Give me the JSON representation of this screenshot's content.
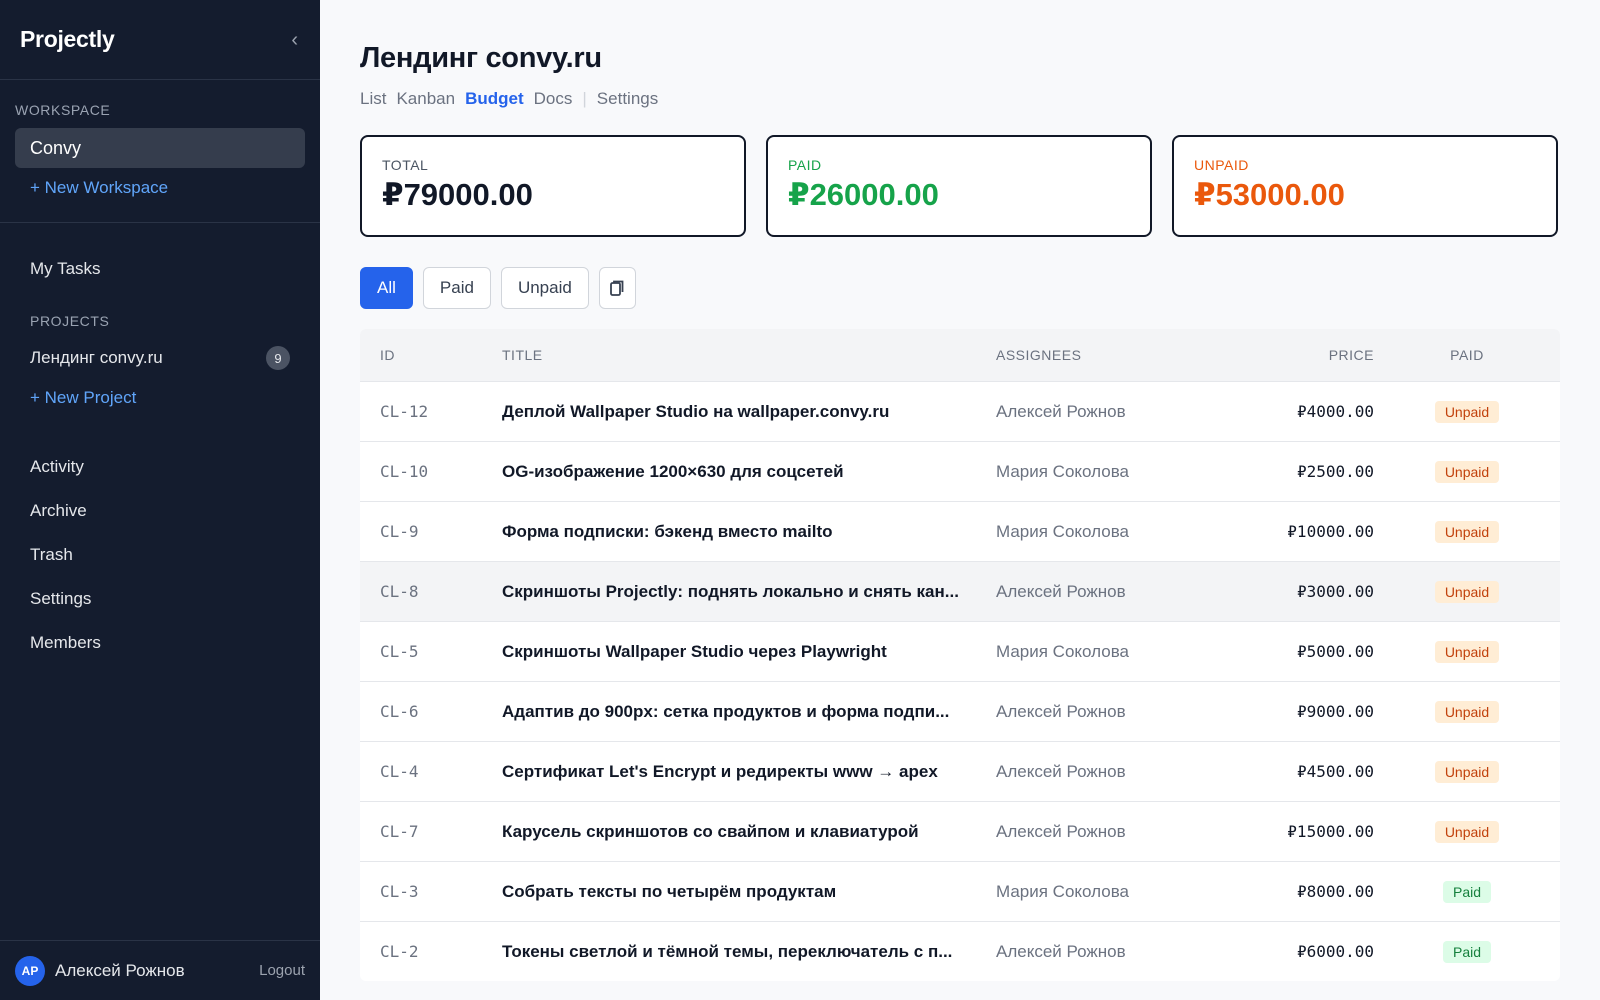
{
  "app": {
    "brand": "Projectly",
    "collapse_glyph": "‹"
  },
  "sidebar": {
    "workspace_label": "WORKSPACE",
    "workspace": "Convy",
    "new_workspace": "+ New Workspace",
    "my_tasks": "My Tasks",
    "projects_label": "PROJECTS",
    "project": {
      "name": "Лендинг convy.ru",
      "count": "9"
    },
    "new_project": "+ New Project",
    "nav": [
      "Activity",
      "Archive",
      "Trash",
      "Settings",
      "Members"
    ],
    "user": {
      "initials": "АР",
      "name": "Алексей Рожнов",
      "logout": "Logout"
    }
  },
  "page": {
    "title": "Лендинг convy.ru",
    "tabs": [
      "List",
      "Kanban",
      "Budget",
      "Docs"
    ],
    "active_tab": "Budget",
    "tab_separator": "|",
    "settings_tab": "Settings"
  },
  "summary": {
    "total": {
      "label": "TOTAL",
      "value": "₽79000.00"
    },
    "paid": {
      "label": "PAID",
      "value": "₽26000.00"
    },
    "unpaid": {
      "label": "UNPAID",
      "value": "₽53000.00"
    }
  },
  "filters": {
    "all": "All",
    "paid": "Paid",
    "unpaid": "Unpaid",
    "icon": "clipboard-icon"
  },
  "table": {
    "headers": {
      "id": "ID",
      "title": "TITLE",
      "assignees": "ASSIGNEES",
      "price": "PRICE",
      "paid": "PAID"
    },
    "rows": [
      {
        "id": "CL-12",
        "title": "Деплой Wallpaper Studio на wallpaper.convy.ru",
        "assignee": "Алексей Рожнов",
        "price": "₽4000.00",
        "status": "Unpaid"
      },
      {
        "id": "CL-10",
        "title": "OG-изображение 1200×630 для соцсетей",
        "assignee": "Мария Соколова",
        "price": "₽2500.00",
        "status": "Unpaid"
      },
      {
        "id": "CL-9",
        "title": "Форма подписки: бэкенд вместо mailto",
        "assignee": "Мария Соколова",
        "price": "₽10000.00",
        "status": "Unpaid"
      },
      {
        "id": "CL-8",
        "title": "Скриншоты Projectly: поднять локально и снять кан...",
        "assignee": "Алексей Рожнов",
        "price": "₽3000.00",
        "status": "Unpaid"
      },
      {
        "id": "CL-5",
        "title": "Скриншоты Wallpaper Studio через Playwright",
        "assignee": "Мария Соколова",
        "price": "₽5000.00",
        "status": "Unpaid"
      },
      {
        "id": "CL-6",
        "title": "Адаптив до 900px: сетка продуктов и форма подпи...",
        "assignee": "Алексей Рожнов",
        "price": "₽9000.00",
        "status": "Unpaid"
      },
      {
        "id": "CL-4",
        "title": "Сертификат Let's Encrypt и редиректы www → apex",
        "assignee": "Алексей Рожнов",
        "price": "₽4500.00",
        "status": "Unpaid"
      },
      {
        "id": "CL-7",
        "title": "Карусель скриншотов со свайпом и клавиатурой",
        "assignee": "Алексей Рожнов",
        "price": "₽15000.00",
        "status": "Unpaid"
      },
      {
        "id": "CL-3",
        "title": "Собрать тексты по четырём продуктам",
        "assignee": "Мария Соколова",
        "price": "₽8000.00",
        "status": "Paid"
      },
      {
        "id": "CL-2",
        "title": "Токены светлой и тёмной темы, переключатель с п...",
        "assignee": "Алексей Рожнов",
        "price": "₽6000.00",
        "status": "Paid"
      }
    ]
  }
}
